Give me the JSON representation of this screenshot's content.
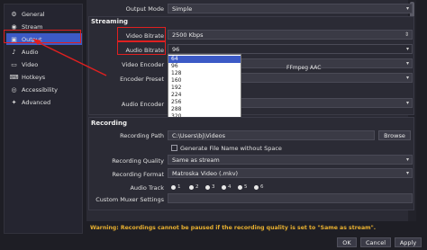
{
  "sidebar": {
    "items": [
      {
        "label": "General",
        "icon": "gear-icon",
        "glyph": "⚙"
      },
      {
        "label": "Stream",
        "icon": "globe-icon",
        "glyph": "◉"
      },
      {
        "label": "Output",
        "icon": "output-icon",
        "glyph": "▣"
      },
      {
        "label": "Audio",
        "icon": "speaker-icon",
        "glyph": "♪"
      },
      {
        "label": "Video",
        "icon": "monitor-icon",
        "glyph": "▭"
      },
      {
        "label": "Hotkeys",
        "icon": "keyboard-icon",
        "glyph": "⌨"
      },
      {
        "label": "Accessibility",
        "icon": "accessibility-icon",
        "glyph": "◎"
      },
      {
        "label": "Advanced",
        "icon": "wrench-icon",
        "glyph": "✦"
      }
    ],
    "active_index": 2
  },
  "output_mode": {
    "label": "Output Mode",
    "value": "Simple"
  },
  "streaming": {
    "title": "Streaming",
    "video_bitrate": {
      "label": "Video Bitrate",
      "value": "2500 Kbps"
    },
    "audio_bitrate": {
      "label": "Audio Bitrate",
      "value": "96"
    },
    "video_encoder": {
      "label": "Video Encoder"
    },
    "encoder_preset": {
      "label": "Encoder Preset"
    },
    "audio_encoder": {
      "label": "Audio Encoder",
      "value": "FFmpeg AAC"
    }
  },
  "audio_bitrate_options": [
    "64",
    "96",
    "128",
    "160",
    "192",
    "224",
    "256",
    "288",
    "320"
  ],
  "audio_bitrate_selected": "64",
  "recording": {
    "title": "Recording",
    "path": {
      "label": "Recording Path",
      "value": "C:\\Users\\bj\\Videos",
      "browse": "Browse"
    },
    "no_space": {
      "label": "Generate File Name without Space"
    },
    "quality": {
      "label": "Recording Quality",
      "value": "Same as stream"
    },
    "format": {
      "label": "Recording Format",
      "value": "Matroska Video (.mkv)"
    },
    "audio_track": {
      "label": "Audio Track",
      "tracks": [
        "1",
        "2",
        "3",
        "4",
        "5",
        "6"
      ]
    },
    "muxer": {
      "label": "Custom Muxer Settings"
    }
  },
  "warning": "Warning: Recordings cannot be paused if the recording quality is set to \"Same as stream\".",
  "footer": {
    "ok": "OK",
    "cancel": "Cancel",
    "apply": "Apply"
  }
}
